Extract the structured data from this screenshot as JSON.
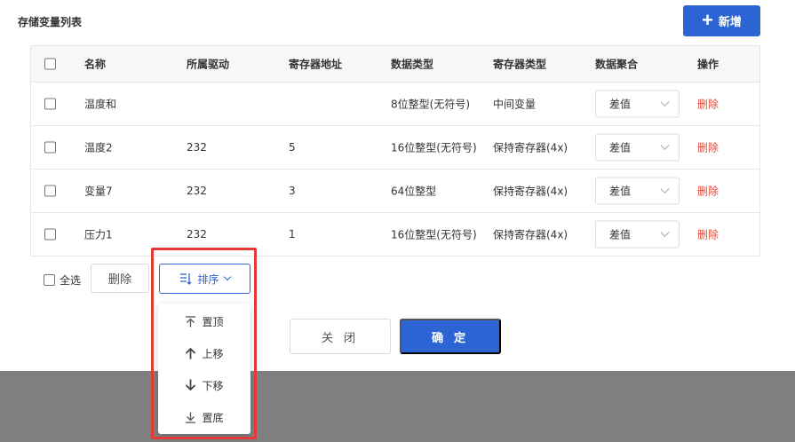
{
  "page": {
    "title": "存储变量列表",
    "add_label": "新增"
  },
  "table": {
    "headers": [
      "名称",
      "所属驱动",
      "寄存器地址",
      "数据类型",
      "寄存器类型",
      "数据聚合",
      "操作"
    ],
    "rows": [
      {
        "name": "温度和",
        "driver": "",
        "address": "",
        "data_type": "8位整型(无符号)",
        "register_type": "中间变量",
        "aggregate": "差值",
        "action": "删除"
      },
      {
        "name": "温度2",
        "driver": "232",
        "address": "5",
        "data_type": "16位整型(无符号)",
        "register_type": "保持寄存器(4x)",
        "aggregate": "差值",
        "action": "删除"
      },
      {
        "name": "变量7",
        "driver": "232",
        "address": "3",
        "data_type": "64位整型",
        "register_type": "保持寄存器(4x)",
        "aggregate": "差值",
        "action": "删除"
      },
      {
        "name": "压力1",
        "driver": "232",
        "address": "1",
        "data_type": "16位整型(无符号)",
        "register_type": "保持寄存器(4x)",
        "aggregate": "差值",
        "action": "删除"
      }
    ]
  },
  "footer": {
    "select_all_label": "全选",
    "delete_label": "删除",
    "sort_label": "排序",
    "close_label": "关 闭",
    "confirm_label": "确 定"
  },
  "sort_menu": {
    "items": [
      {
        "label": "置顶",
        "icon": "to-top-icon"
      },
      {
        "label": "上移",
        "icon": "arrow-up-icon"
      },
      {
        "label": "下移",
        "icon": "arrow-down-icon"
      },
      {
        "label": "置底",
        "icon": "to-bottom-icon"
      }
    ]
  },
  "colors": {
    "primary": "#2d64d3",
    "danger": "#e04a3a",
    "highlight": "#e53935",
    "overlay": "#7f7f7f"
  }
}
